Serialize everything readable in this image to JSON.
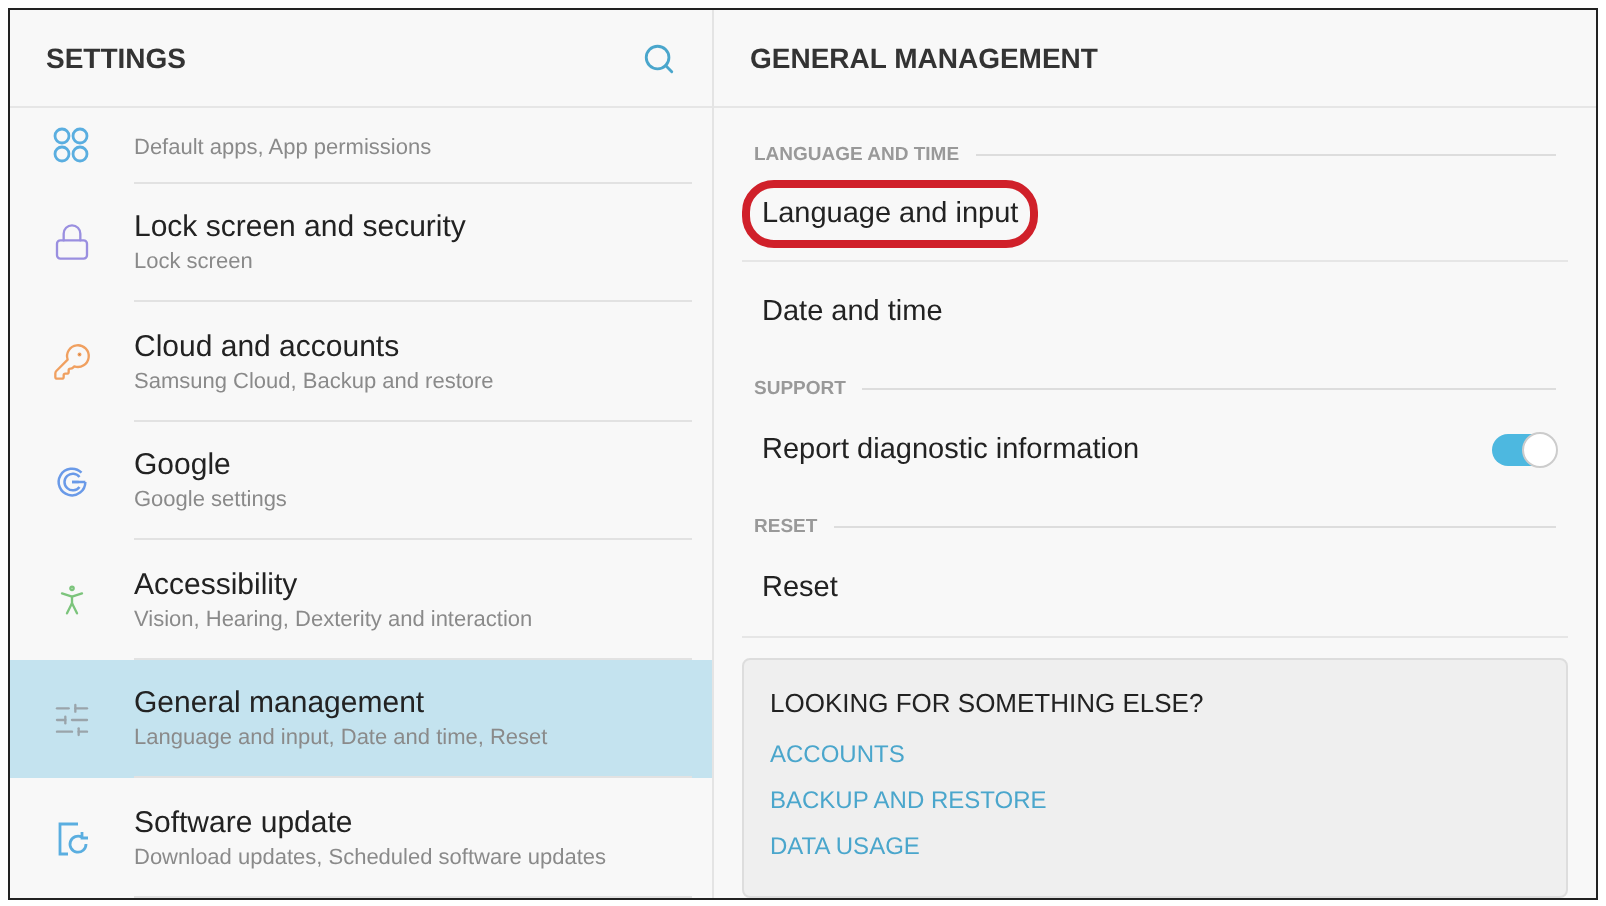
{
  "sidebar": {
    "title": "SETTINGS",
    "items": [
      {
        "kind": "apps",
        "color": "#5aaee0",
        "subtitle": "Default apps, App permissions",
        "selected": false
      },
      {
        "kind": "lock",
        "color": "#9a8fe0",
        "title": "Lock screen and security",
        "subtitle": "Lock screen",
        "selected": false
      },
      {
        "kind": "key",
        "color": "#f0a060",
        "title": "Cloud and accounts",
        "subtitle": "Samsung Cloud, Backup and restore",
        "selected": false
      },
      {
        "kind": "google",
        "color": "#6a9ae8",
        "title": "Google",
        "subtitle": "Google settings",
        "selected": false
      },
      {
        "kind": "accessibility",
        "color": "#7cc47c",
        "title": "Accessibility",
        "subtitle": "Vision, Hearing, Dexterity and interaction",
        "selected": false
      },
      {
        "kind": "sliders",
        "color": "#9aa4aa",
        "title": "General management",
        "subtitle": "Language and input, Date and time, Reset",
        "selected": true
      },
      {
        "kind": "update",
        "color": "#5aaee0",
        "title": "Software update",
        "subtitle": "Download updates, Scheduled software updates",
        "selected": false
      }
    ]
  },
  "detail": {
    "title": "GENERAL MANAGEMENT",
    "sections": [
      {
        "header": "LANGUAGE AND TIME",
        "items": [
          {
            "kind": "plain",
            "label": "Language and input",
            "highlighted": true
          },
          {
            "kind": "plain",
            "label": "Date and time",
            "highlighted": false
          }
        ]
      },
      {
        "header": "SUPPORT",
        "items": [
          {
            "kind": "toggle",
            "label": "Report diagnostic information",
            "on": true,
            "highlighted": false
          }
        ]
      },
      {
        "header": "RESET",
        "items": [
          {
            "kind": "plain",
            "label": "Reset",
            "highlighted": false
          }
        ]
      }
    ],
    "suggestions": {
      "title": "LOOKING FOR SOMETHING ELSE?",
      "links": [
        "ACCOUNTS",
        "BACKUP AND RESTORE",
        "DATA USAGE"
      ]
    }
  }
}
